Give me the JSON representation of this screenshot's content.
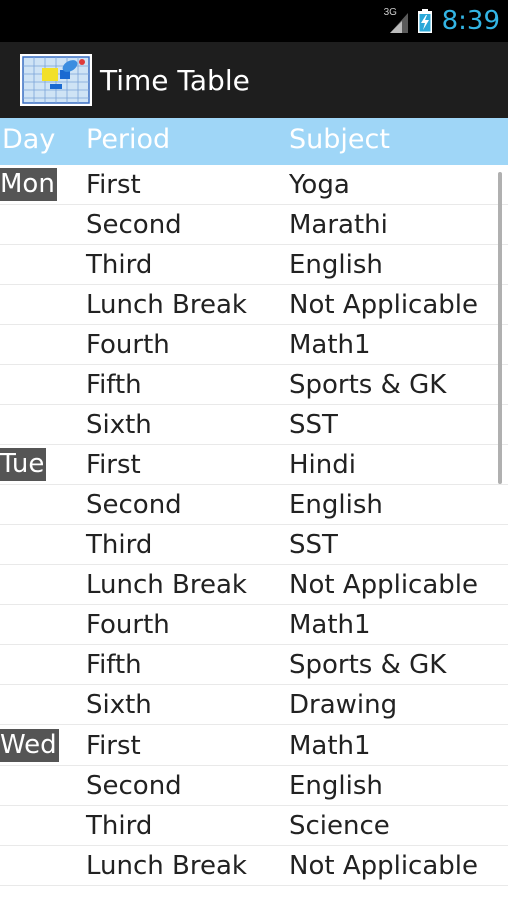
{
  "status_bar": {
    "network": "3G",
    "time": "8:39",
    "signal_icon": "signal-icon",
    "battery_icon": "battery-charging-icon"
  },
  "action_bar": {
    "title": "Time Table",
    "icon": "timetable-app-icon"
  },
  "table": {
    "headers": {
      "day": "Day",
      "period": "Period",
      "subject": "Subject"
    },
    "rows": [
      {
        "day": "Mon",
        "period": "First",
        "subject": "Yoga"
      },
      {
        "day": "",
        "period": "Second",
        "subject": "Marathi"
      },
      {
        "day": "",
        "period": "Third",
        "subject": "English"
      },
      {
        "day": "",
        "period": "Lunch Break",
        "subject": "Not Applicable"
      },
      {
        "day": "",
        "period": "Fourth",
        "subject": "Math1"
      },
      {
        "day": "",
        "period": "Fifth",
        "subject": "Sports & GK"
      },
      {
        "day": "",
        "period": "Sixth",
        "subject": "SST"
      },
      {
        "day": "Tue",
        "period": "First",
        "subject": "Hindi"
      },
      {
        "day": "",
        "period": "Second",
        "subject": "English"
      },
      {
        "day": "",
        "period": "Third",
        "subject": "SST"
      },
      {
        "day": "",
        "period": "Lunch Break",
        "subject": "Not Applicable"
      },
      {
        "day": "",
        "period": "Fourth",
        "subject": "Math1"
      },
      {
        "day": "",
        "period": "Fifth",
        "subject": "Sports & GK"
      },
      {
        "day": "",
        "period": "Sixth",
        "subject": "Drawing"
      },
      {
        "day": "Wed",
        "period": "First",
        "subject": "Math1"
      },
      {
        "day": "",
        "period": "Second",
        "subject": "English"
      },
      {
        "day": "",
        "period": "Third",
        "subject": "Science"
      },
      {
        "day": "",
        "period": "Lunch Break",
        "subject": "Not Applicable"
      }
    ]
  },
  "colors": {
    "header_bg": "#9fd6f7",
    "day_badge_bg": "#555555",
    "clock": "#33b5e5",
    "action_bar_bg": "#1e1e1e"
  }
}
